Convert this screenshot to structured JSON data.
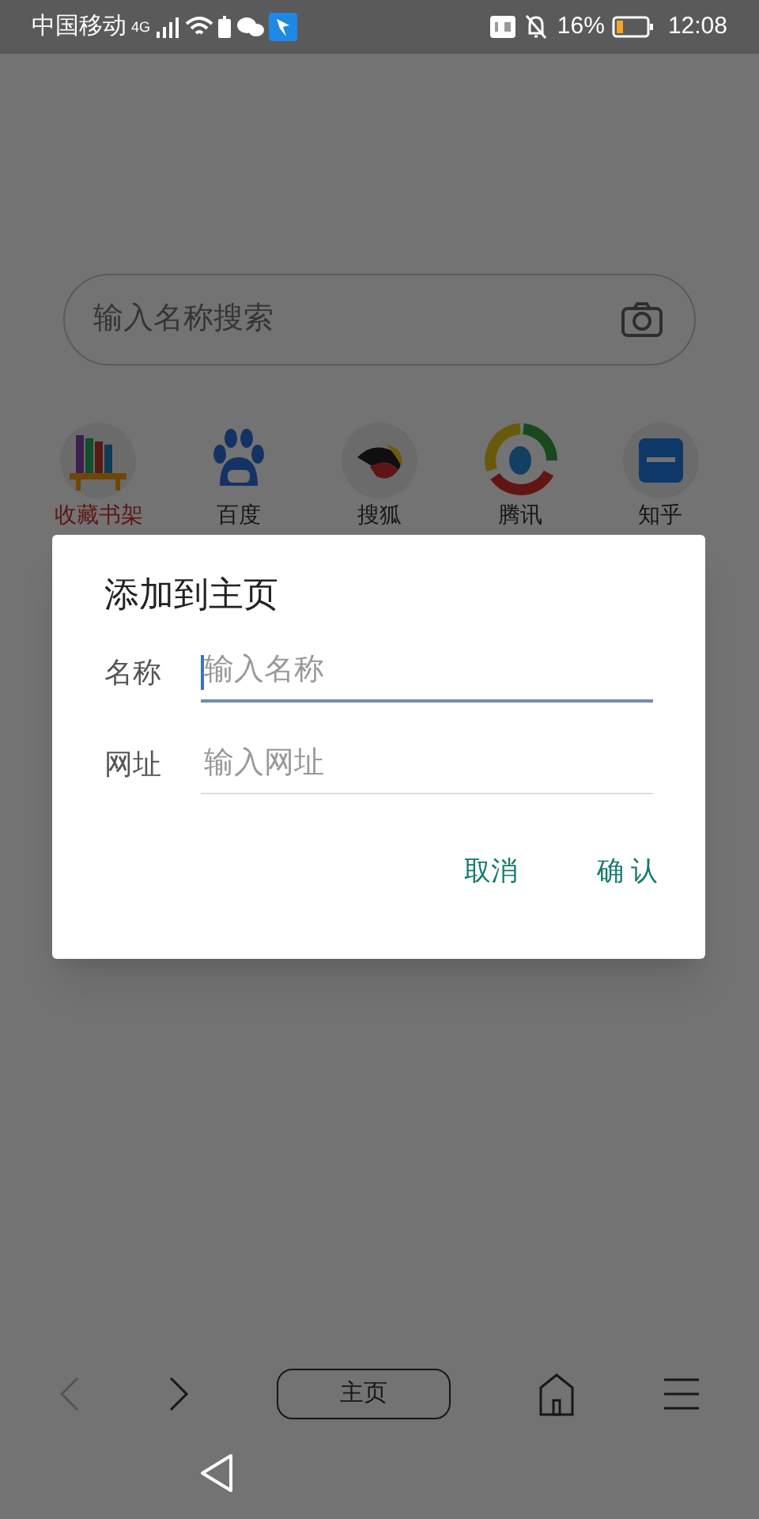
{
  "status_bar": {
    "carrier": "中国移动",
    "network": "4G",
    "battery": "16%",
    "time": "12:08"
  },
  "search": {
    "placeholder": "输入名称搜索"
  },
  "shortcuts": [
    {
      "label": "收藏书架",
      "selected": true
    },
    {
      "label": "百度",
      "selected": false
    },
    {
      "label": "搜狐",
      "selected": false
    },
    {
      "label": "腾讯",
      "selected": false
    },
    {
      "label": "知乎",
      "selected": false
    }
  ],
  "dialog": {
    "title": "添加到主页",
    "fields": [
      {
        "label": "名称",
        "placeholder": "输入名称",
        "focused": true
      },
      {
        "label": "网址",
        "placeholder": "输入网址",
        "focused": false
      }
    ],
    "buttons": [
      "取消",
      "确 认"
    ]
  },
  "bottom_bar": {
    "home_label": "主页"
  }
}
